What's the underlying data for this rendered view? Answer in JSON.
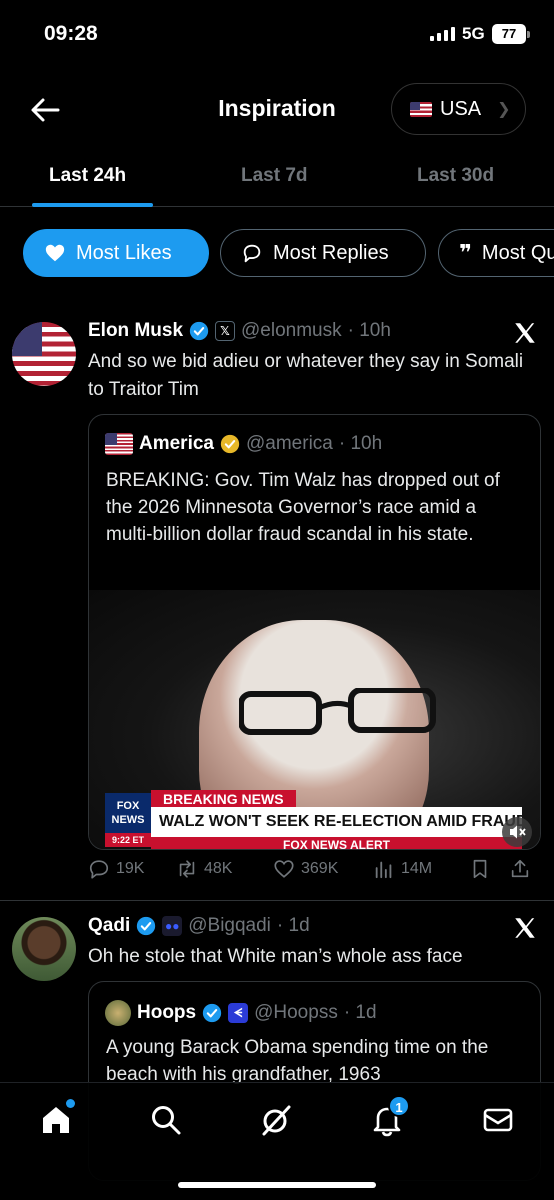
{
  "status_bar": {
    "time": "09:28",
    "network": "5G",
    "battery": "77"
  },
  "header": {
    "title": "Inspiration",
    "country": "USA"
  },
  "time_tabs": [
    "Last 24h",
    "Last 7d",
    "Last 30d"
  ],
  "active_time_tab": "Last 24h",
  "filters": [
    "Most Likes",
    "Most Replies",
    "Most Quotes"
  ],
  "active_filter": "Most Likes",
  "posts": [
    {
      "name": "Elon Musk",
      "handle": "@elonmusk",
      "time": "· 10h",
      "text": "And so we bid adieu or whatever they say in Somali to Traitor Tim",
      "quote": {
        "name": "America",
        "handle": "@america",
        "time": "· 10h",
        "text": "BREAKING: Gov. Tim Walz has dropped out of the 2026 Minnesota Governor’s race amid a multi-billion dollar fraud scandal in his state.",
        "banner_label": "BREAKING NEWS",
        "banner_headline": "WALZ WON'T SEEK RE-ELECTION AMID FRAUD SCANDAL",
        "banner_alert": "FOX NEWS ALERT",
        "banner_logo": "FOX NEWS",
        "banner_time": "9:22 ET"
      },
      "stats": {
        "replies": "19K",
        "reposts": "48K",
        "likes": "369K",
        "views": "14M"
      }
    },
    {
      "name": "Qadi",
      "handle": "@Bigqadi",
      "time": "· 1d",
      "text": "Oh he stole that White man’s whole ass face",
      "quote": {
        "name": "Hoops",
        "handle": "@Hoopss",
        "time": "· 1d",
        "text": "A young Barack Obama spending time on the beach with his grandfather, 1963"
      }
    }
  ],
  "bottom_nav": {
    "notifications_count": "1"
  },
  "colors": {
    "accent": "#1d9bf0",
    "verified": "#1d9bf0",
    "gold_badge": "#e8b829"
  }
}
